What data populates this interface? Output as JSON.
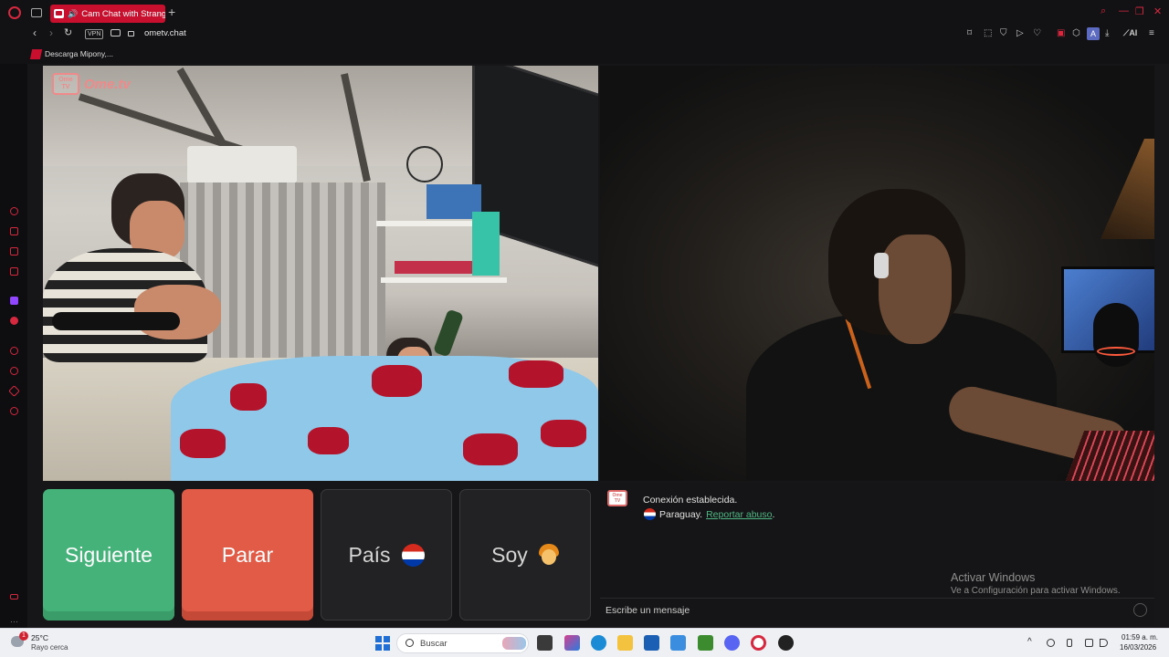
{
  "browser": {
    "tab_title": "Cam Chat with Strange",
    "url": "ometv.chat",
    "vpn_label": "VPN",
    "bookmark_label": "Descarga Mipony,...",
    "ai_label": "AI",
    "profile_letter": "A"
  },
  "logo": {
    "box_top": "Ome",
    "box_bottom": "TV",
    "text": "Ome.tv"
  },
  "controls": {
    "next_label": "Siguiente",
    "stop_label": "Parar",
    "country_label": "País",
    "gender_label": "Soy"
  },
  "chat": {
    "logo_top": "Ome",
    "logo_bottom": "TV",
    "message_connected": "Conexión establecida.",
    "country_text": "Paraguay.",
    "report_link": "Reportar abuso",
    "report_suffix": ".",
    "input_placeholder": "Escribe un mensaje",
    "watermark_title": "Activar Windows",
    "watermark_subtitle": "Ve a Configuración para activar Windows."
  },
  "taskbar": {
    "weather_badge": "1",
    "temperature": "25°C",
    "weather_desc": "Rayo cerca",
    "search_label": "Buscar",
    "time": "01:59 a. m.",
    "date": "16/03/2026"
  },
  "colors": {
    "opera_red": "#d6283f",
    "next_green": "#45b27a",
    "stop_red": "#e15b46",
    "link_green": "#4fb784"
  }
}
